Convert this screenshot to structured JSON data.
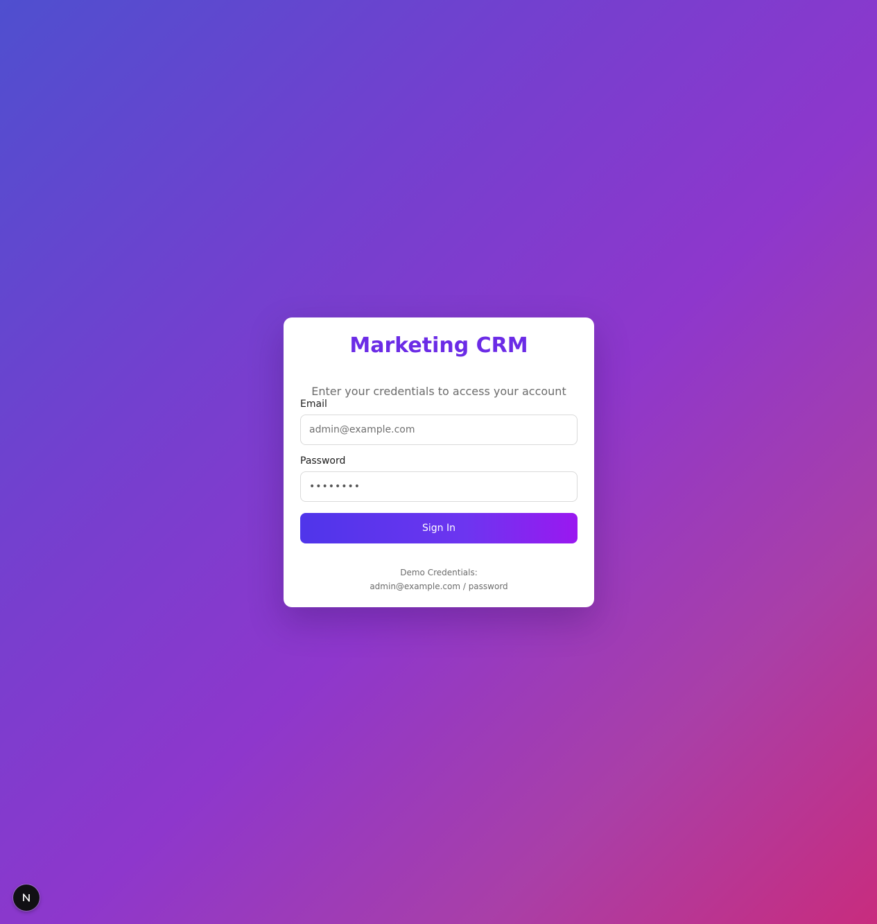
{
  "login": {
    "title": "Marketing CRM",
    "subtitle": "Enter your credentials to access your account",
    "email_label": "Email",
    "email_placeholder": "admin@example.com",
    "email_value": "",
    "password_label": "Password",
    "password_placeholder": "••••••••",
    "password_value": "",
    "submit_label": "Sign In",
    "demo_heading": "Demo Credentials:",
    "demo_credentials": "admin@example.com / password"
  },
  "dev_indicator": {
    "icon": "nextjs-logo-icon",
    "letter": "N"
  },
  "colors": {
    "title": "#6b2be6",
    "button_start": "#4f35ea",
    "button_end": "#9a18f0",
    "background_start": "#4f4fcf",
    "background_end": "#c82c7e"
  }
}
